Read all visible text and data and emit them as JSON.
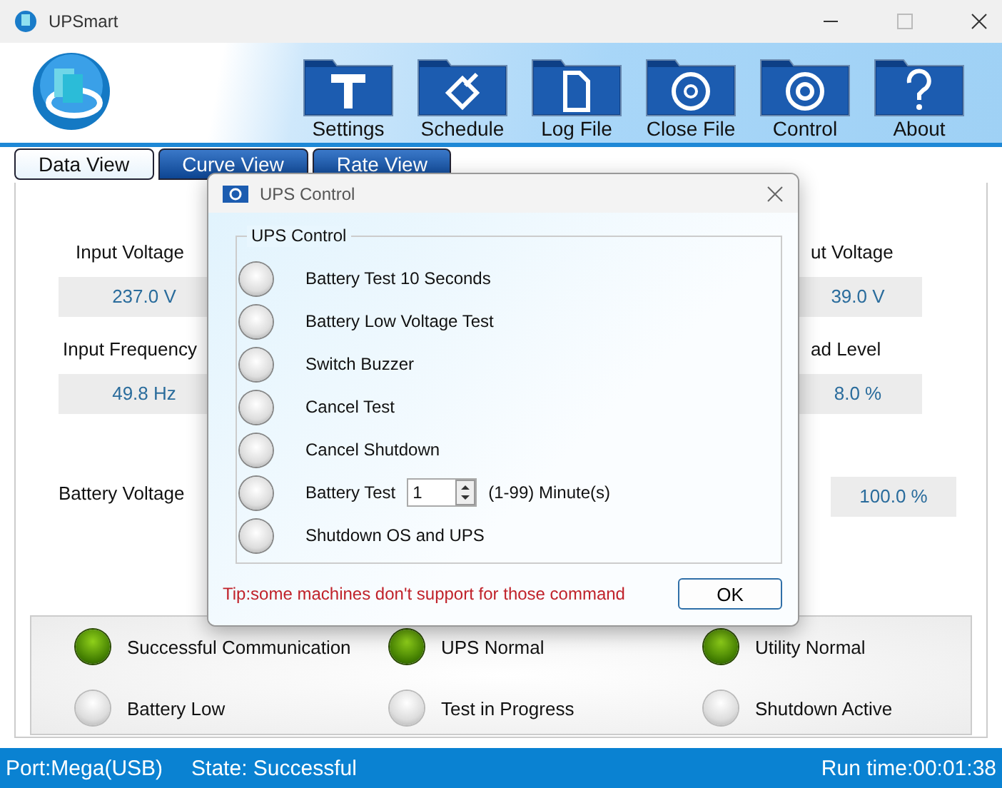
{
  "window": {
    "title": "UPSmart"
  },
  "toolbar": [
    {
      "label": "Settings"
    },
    {
      "label": "Schedule"
    },
    {
      "label": "Log File"
    },
    {
      "label": "Close File"
    },
    {
      "label": "Control"
    },
    {
      "label": "About"
    }
  ],
  "tabs": [
    {
      "label": "Data View",
      "selected": true
    },
    {
      "label": "Curve View",
      "selected": false
    },
    {
      "label": "Rate View",
      "selected": false
    }
  ],
  "left_readings": [
    {
      "label": "Input Voltage",
      "value": "237.0 V"
    },
    {
      "label": "Input Frequency",
      "value": "49.8 Hz"
    }
  ],
  "battery_voltage_label": "Battery Voltage",
  "right_readings": [
    {
      "label": "ut Voltage",
      "value": "39.0 V"
    },
    {
      "label": "ad Level",
      "value": "8.0 %"
    }
  ],
  "battery_capacity_value": "100.0 %",
  "indicators": [
    {
      "label": "Successful Communication",
      "on": true
    },
    {
      "label": "UPS Normal",
      "on": true
    },
    {
      "label": "Utility Normal",
      "on": true
    },
    {
      "label": "Battery Low",
      "on": false
    },
    {
      "label": "Test in Progress",
      "on": false
    },
    {
      "label": "Shutdown Active",
      "on": false
    }
  ],
  "status_bar": {
    "port": "Port:Mega(USB)",
    "state": "State: Successful",
    "run_time": "Run time:00:01:38"
  },
  "dialog": {
    "title": "UPS Control",
    "group_title": "UPS Control",
    "options": [
      {
        "kind": "plain",
        "label": "Battery Test 10 Seconds",
        "selected": false
      },
      {
        "kind": "plain",
        "label": "Battery Low Voltage Test",
        "selected": false
      },
      {
        "kind": "plain",
        "label": "Switch Buzzer",
        "selected": false
      },
      {
        "kind": "plain",
        "label": "Cancel Test",
        "selected": false
      },
      {
        "kind": "plain",
        "label": "Cancel Shutdown",
        "selected": false
      },
      {
        "kind": "spin",
        "label": "Battery Test",
        "value": "1",
        "suffix": "(1-99) Minute(s)",
        "selected": false
      },
      {
        "kind": "plain",
        "label": "Shutdown OS and UPS",
        "selected": false
      }
    ],
    "tip": "Tip:some machines don't support for those command",
    "ok": "OK"
  }
}
